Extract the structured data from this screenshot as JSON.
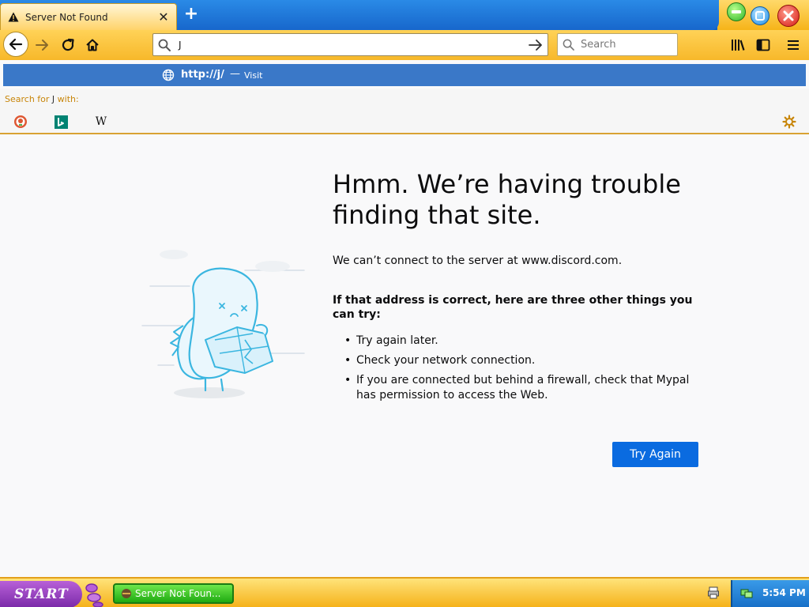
{
  "window": {
    "tab_title": "Server Not Found",
    "close_tab_symbol": "✕",
    "new_tab_symbol": "+"
  },
  "toolbar": {
    "url_value": "J",
    "search_placeholder": "Search"
  },
  "suggestion": {
    "url": "http://j/",
    "separator": "—",
    "action": "Visit",
    "search_header_prefix": "Search for ",
    "search_query": "J",
    "search_header_suffix": " with:",
    "engines": [
      "duckduckgo-icon",
      "bing-icon",
      "wikipedia-icon"
    ],
    "wikipedia_letter": "W"
  },
  "error": {
    "title": "Hmm. We’re having trouble finding that site.",
    "description": "We can’t connect to the server at www.discord.com.",
    "subheading": "If that address is correct, here are three other things you can try:",
    "items": [
      "Try again later.",
      "Check your network connection.",
      "If you are connected but behind a firewall, check that Mypal has permission to access the Web."
    ],
    "button": "Try Again"
  },
  "taskbar": {
    "start_label": "START",
    "task_label": "Server Not Foun...",
    "clock": "5:54 PM"
  },
  "colors": {
    "accent_blue": "#0a6be0",
    "toolbar_yellow": "#f7b82a",
    "suggest_blue": "#3a78c8",
    "hint_orange": "#c8860a"
  }
}
